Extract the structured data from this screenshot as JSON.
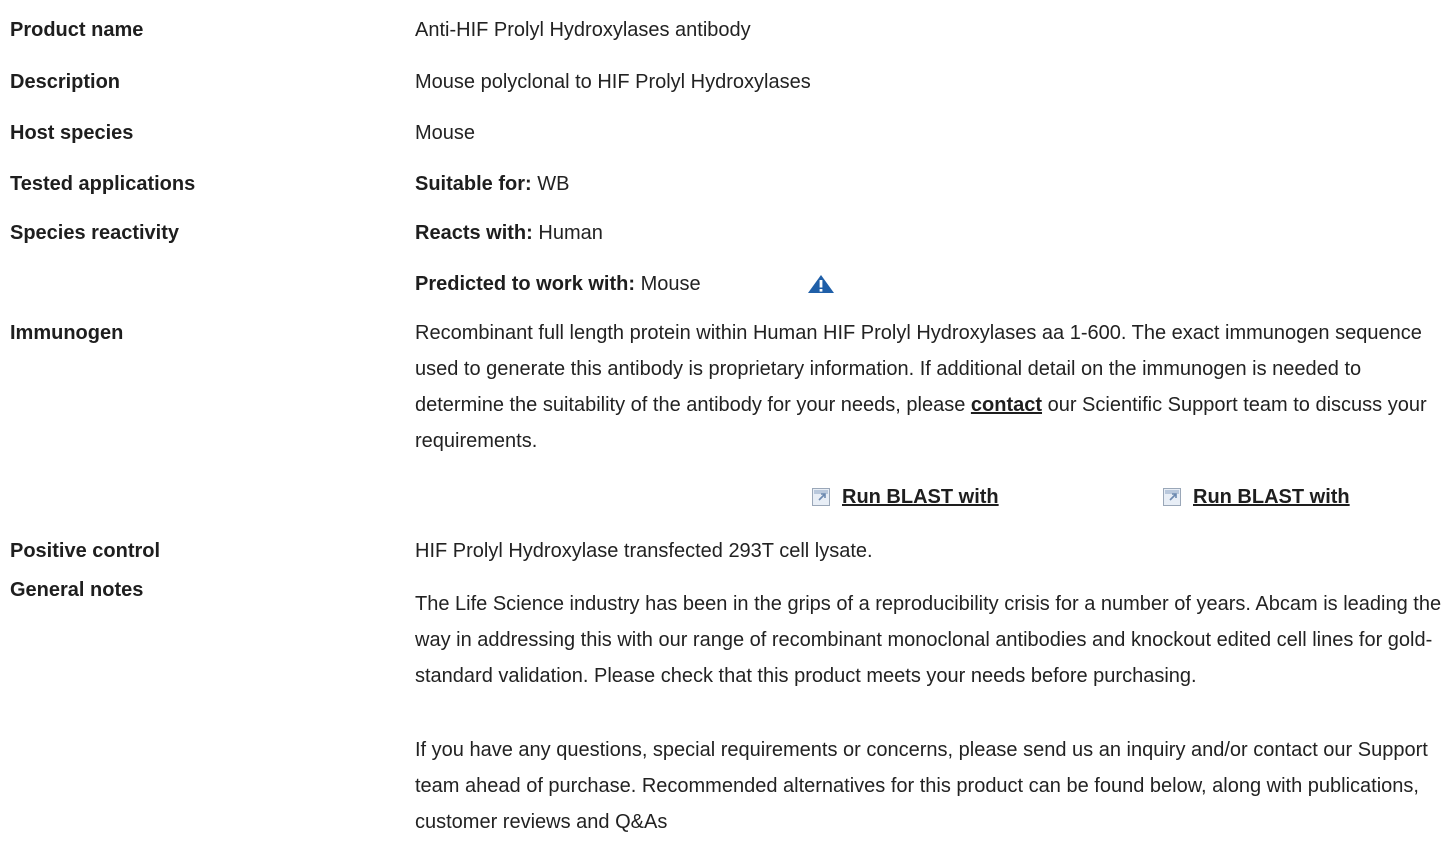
{
  "fields": {
    "product_name": {
      "label": "Product name",
      "value": "Anti-HIF Prolyl Hydroxylases antibody"
    },
    "description": {
      "label": "Description",
      "value": "Mouse polyclonal to HIF Prolyl Hydroxylases"
    },
    "host_species": {
      "label": "Host species",
      "value": "Mouse"
    },
    "tested_applications": {
      "label": "Tested applications",
      "prefix": "Suitable for:",
      "value": "WB"
    },
    "species_reactivity": {
      "label": "Species reactivity",
      "reacts_prefix": "Reacts with:",
      "reacts_value": "Human",
      "predicted_prefix": "Predicted to work with:",
      "predicted_value": "Mouse",
      "predicted_icon": "warning-triangle-icon"
    },
    "immunogen": {
      "label": "Immunogen",
      "text_before": "Recombinant full length protein within Human HIF Prolyl Hydroxylases aa 1-600. The exact immunogen sequence used to generate this antibody is proprietary information. If additional detail on the immunogen is needed to determine the suitability of the antibody for your needs, please ",
      "link_text": "contact",
      "text_after": " our Scientific Support team to discuss your requirements.",
      "blast_links": [
        "Run BLAST with",
        "Run BLAST with"
      ]
    },
    "positive_control": {
      "label": "Positive control",
      "value": "HIF Prolyl Hydroxylase transfected 293T cell lysate."
    },
    "general_notes": {
      "label": "General notes",
      "paragraph1": "The Life Science industry has been in the grips of a reproducibility crisis for a number of years. Abcam is leading the way in addressing this with our range of recombinant monoclonal antibodies and knockout edited cell lines for gold-standard validation. Please check that this product meets your needs before purchasing.",
      "paragraph2": "If you have any questions, special requirements or concerns, please send us an inquiry and/or contact our Support team ahead of purchase. Recommended alternatives for this product can be found below, along with publications, customer reviews and Q&As"
    }
  },
  "colors": {
    "text": "#222222",
    "warning_icon": "#1f5fa8",
    "link": "#1e1e1e"
  }
}
